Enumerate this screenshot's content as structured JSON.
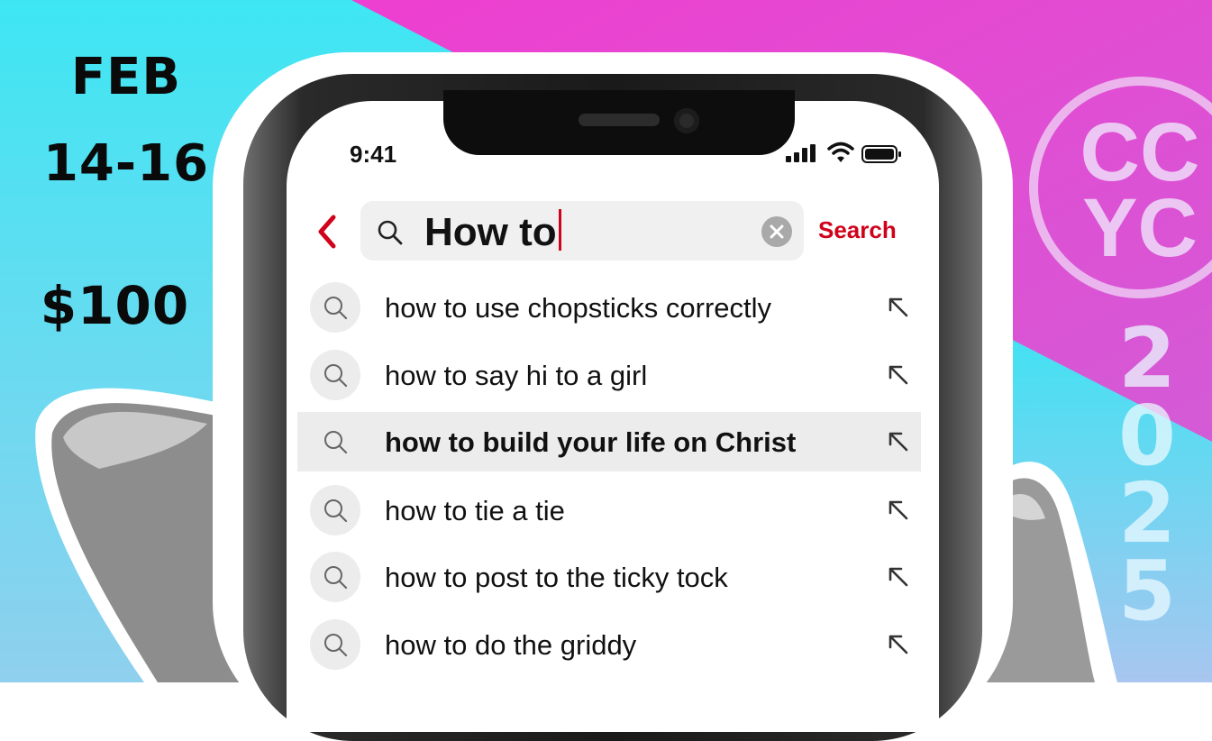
{
  "event": {
    "month": "FEB",
    "days": "14-16",
    "price": "$100"
  },
  "brand": {
    "logo_line1": "CC",
    "logo_line2": "YC",
    "year_digits": [
      "2",
      "0",
      "2",
      "5"
    ]
  },
  "status_bar": {
    "time": "9:41"
  },
  "search": {
    "query": "How to",
    "submit_label": "Search"
  },
  "suggestions": [
    {
      "text": "how to use chopsticks correctly",
      "highlighted": false
    },
    {
      "text": "how to say hi to a girl",
      "highlighted": false
    },
    {
      "text": "how to build your life on Christ",
      "highlighted": true
    },
    {
      "text": "how to tie a tie",
      "highlighted": false
    },
    {
      "text": "how to post to the ticky tock",
      "highlighted": false
    },
    {
      "text": "how to do the griddy",
      "highlighted": false
    }
  ],
  "colors": {
    "cyan": "#2fe0f0",
    "magenta": "#e640d2",
    "accent_red": "#d0021b"
  },
  "icons": [
    "back-icon",
    "search-icon",
    "clear-icon",
    "signal-icon",
    "wifi-icon",
    "battery-icon",
    "arrow-up-left-icon"
  ]
}
